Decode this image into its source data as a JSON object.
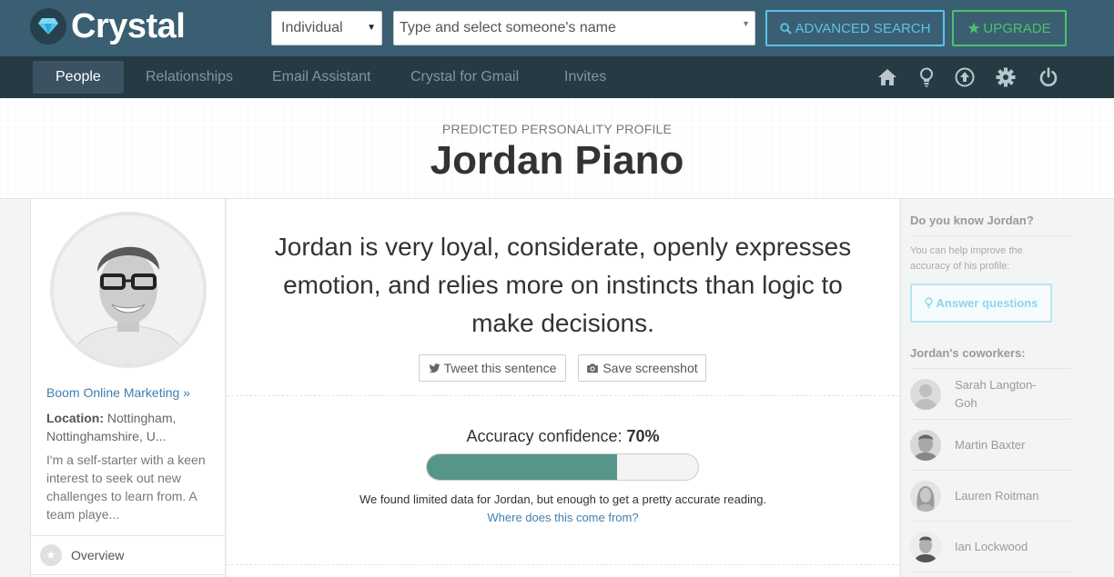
{
  "app": {
    "name": "Crystal"
  },
  "topbar": {
    "type_select": {
      "value": "Individual"
    },
    "search": {
      "placeholder": "Type and select someone's name"
    },
    "advanced_search_label": "ADVANCED SEARCH",
    "upgrade_label": "UPGRADE",
    "colors": {
      "bar_bg": "#3a5f73",
      "advanced": "#5cc3e8",
      "upgrade": "#4cc26a"
    }
  },
  "nav": {
    "items": [
      {
        "label": "People",
        "active": true
      },
      {
        "label": "Relationships",
        "active": false
      },
      {
        "label": "Email Assistant",
        "active": false
      },
      {
        "label": "Crystal for Gmail",
        "active": false
      },
      {
        "label": "Invites",
        "active": false
      }
    ],
    "icons": [
      "home-icon",
      "lightbulb-icon",
      "upload-circle-icon",
      "gear-icon",
      "power-icon"
    ]
  },
  "header": {
    "subtitle": "PREDICTED PERSONALITY PROFILE",
    "name": "Jordan Piano"
  },
  "profile": {
    "company": "Boom Online Marketing »",
    "location_label": "Location:",
    "location_value": " Nottingham, Nottinghamshire, U...",
    "bio": "I'm a self-starter with a keen interest to seek out new challenges to learn from. A team playe...",
    "overview_label": "Overview"
  },
  "main": {
    "summary": "Jordan is very loyal, considerate, openly expresses emotion, and relies more on instincts than logic to make decisions.",
    "tweet_label": "Tweet this sentence",
    "screenshot_label": "Save screenshot",
    "accuracy_label": "Accuracy confidence: ",
    "accuracy_value": "70%",
    "accuracy_fraction": 0.7,
    "note": "We found limited data for Jordan, but enough to get a pretty accurate reading.",
    "where_link": "Where does this come from?",
    "colors": {
      "bar_fill": "#56968a",
      "link": "#3f7fb3"
    }
  },
  "sidebar": {
    "know_title": "Do you know Jordan?",
    "help_text": "You can help improve the accuracy of his profile:",
    "answer_label": "Answer questions",
    "coworkers_title": "Jordan's coworkers:",
    "coworkers": [
      {
        "name": "Sarah Langton-Goh"
      },
      {
        "name": "Martin Baxter"
      },
      {
        "name": "Lauren Roitman"
      },
      {
        "name": "Ian Lockwood"
      }
    ]
  }
}
